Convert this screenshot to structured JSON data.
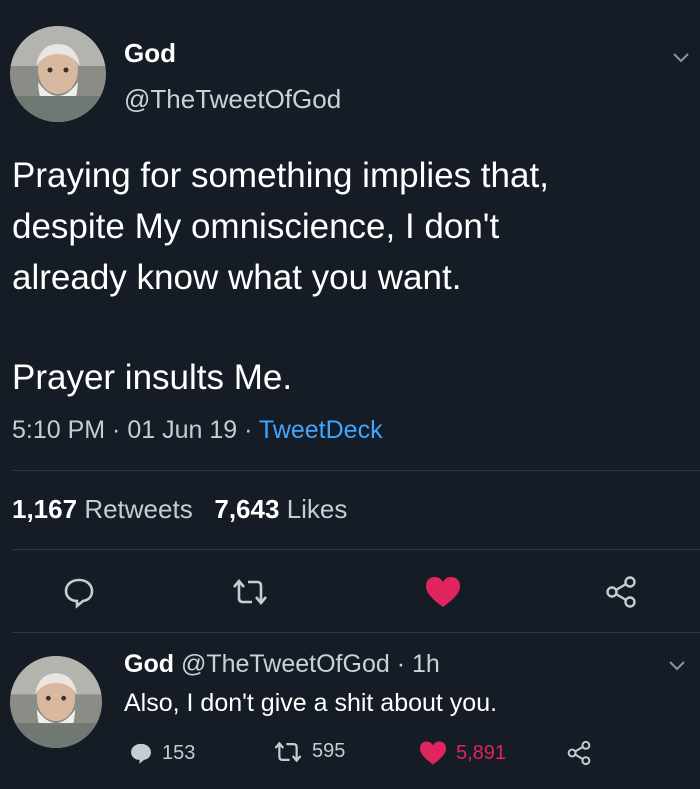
{
  "tweet": {
    "author": {
      "name": "God",
      "handle": "@TheTweetOfGod"
    },
    "text_lines": [
      "Praying for something implies that,",
      "despite My omniscience, I don't",
      "already know what you want.",
      "Prayer insults Me."
    ],
    "time": "5:10 PM",
    "separator": " · ",
    "date": "01 Jun 19",
    "source": "TweetDeck",
    "retweets_count": "1,167",
    "retweets_label": "Retweets",
    "likes_count": "7,643",
    "likes_label": "Likes",
    "liked": true
  },
  "reply": {
    "author_name": "God",
    "handle": "@TheTweetOfGod",
    "age": "1h",
    "separator": "·",
    "text": "Also, I don't give a shit about you.",
    "reply_count": "153",
    "retweet_count": "595",
    "like_count": "5,891"
  },
  "colors": {
    "background": "#151c26",
    "link": "#3ea6ff",
    "like": "#e0245e",
    "muted": "#c4ccd4"
  },
  "icons": [
    "chevron-down-icon",
    "reply-icon",
    "retweet-icon",
    "heart-icon",
    "share-icon"
  ]
}
